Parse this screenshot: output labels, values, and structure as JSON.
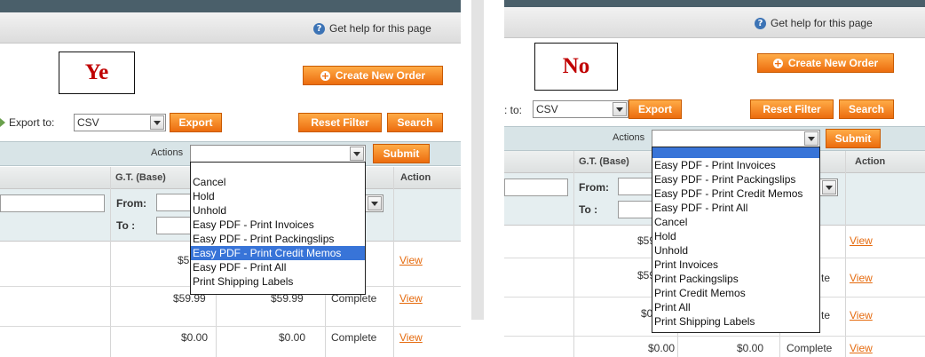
{
  "left": {
    "help_text": "Get help for this page",
    "label": "Ye",
    "create_order": "Create New Order",
    "export_label": "Export to:",
    "export_format": "CSV",
    "export_button": "Export",
    "reset_filter": "Reset Filter",
    "search": "Search",
    "actions_label": "Actions",
    "submit": "Submit",
    "columns": {
      "gt_base": "G.T. (Base)",
      "action": "Action"
    },
    "filter": {
      "from": "From:",
      "to": "To :"
    },
    "dropdown_options": [
      "Cancel",
      "Hold",
      "Unhold",
      "Easy PDF - Print Invoices",
      "Easy PDF - Print Packingslips",
      "Easy PDF - Print Credit Memos",
      "Easy PDF - Print All",
      "Print Shipping Labels"
    ],
    "selected_option": "Easy PDF - Print Credit Memos",
    "rows": [
      {
        "gt_base_partial": "$59",
        "view": "View"
      },
      {
        "gt_base": "$59.99",
        "gt_purchased": "$59.99",
        "status": "Complete",
        "view": "View"
      },
      {
        "gt_base": "$0.00",
        "gt_purchased": "$0.00",
        "status": "Complete",
        "view": "View"
      }
    ]
  },
  "right": {
    "help_text": "Get help for this page",
    "label": "No",
    "create_order": "Create New Order",
    "export_label": ": to:",
    "export_format": "CSV",
    "export_button": "Export",
    "reset_filter": "Reset Filter",
    "search": "Search",
    "actions_label": "Actions",
    "submit": "Submit",
    "columns": {
      "gt_base": "G.T. (Base)",
      "action": "Action"
    },
    "filter": {
      "from": "From:",
      "to": "To :"
    },
    "dropdown_options": [
      "Easy PDF - Print Invoices",
      "Easy PDF - Print Packingslips",
      "Easy PDF - Print Credit Memos",
      "Easy PDF - Print All",
      "Cancel",
      "Hold",
      "Unhold",
      "Print Invoices",
      "Print Packingslips",
      "Print Credit Memos",
      "Print All",
      "Print Shipping Labels"
    ],
    "rows": [
      {
        "gt_base_partial": "$59",
        "view": "View"
      },
      {
        "gt_base_partial": "$59",
        "status_partial": "te",
        "view": "View"
      },
      {
        "gt_base_partial": "$0",
        "status_partial": "te",
        "view": "View"
      },
      {
        "gt_base": "$0.00",
        "gt_purchased": "$0.00",
        "status": "Complete",
        "view": "View"
      }
    ]
  },
  "colors": {
    "accent": "#ec6c0e",
    "link": "#e56b0f",
    "label_red": "#c00000",
    "selected": "#3874d8"
  }
}
